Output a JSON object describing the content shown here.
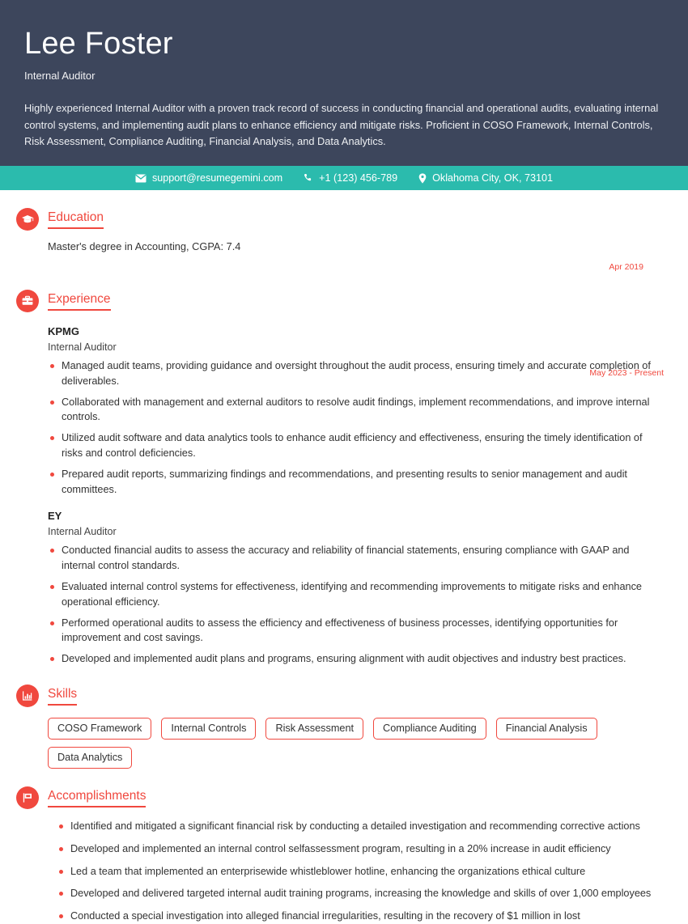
{
  "header": {
    "name": "Lee Foster",
    "job_title": "Internal Auditor",
    "summary": "Highly experienced Internal Auditor with a proven track record of success in conducting financial and operational audits, evaluating internal control systems, and implementing audit plans to enhance efficiency and mitigate risks. Proficient in COSO Framework, Internal Controls, Risk Assessment, Compliance Auditing, Financial Analysis, and Data Analytics."
  },
  "contact": {
    "email": "support@resumegemini.com",
    "phone": "+1 (123) 456-789",
    "location": "Oklahoma City, OK, 73101",
    "email_icon": "envelope-icon",
    "phone_icon": "phone-icon",
    "location_icon": "map-pin-icon"
  },
  "sections": {
    "education": {
      "title": "Education",
      "icon": "graduation-cap-icon",
      "degree": "Master's degree in Accounting, CGPA: 7.4",
      "date": "Apr 2019"
    },
    "experience": {
      "title": "Experience",
      "icon": "briefcase-icon",
      "entries": [
        {
          "company": "KPMG",
          "role": "Internal Auditor",
          "date": "May 2023 - Present",
          "bullets": [
            "Managed audit teams, providing guidance and oversight throughout the audit process, ensuring timely and accurate completion of deliverables.",
            "Collaborated with management and external auditors to resolve audit findings, implement recommendations, and improve internal controls.",
            "Utilized audit software and data analytics tools to enhance audit efficiency and effectiveness, ensuring the timely identification of risks and control deficiencies.",
            "Prepared audit reports, summarizing findings and recommendations, and presenting results to senior management and audit committees."
          ]
        },
        {
          "company": "EY",
          "role": "Internal Auditor",
          "date": "",
          "bullets": [
            "Conducted financial audits to assess the accuracy and reliability of financial statements, ensuring compliance with GAAP and internal control standards.",
            "Evaluated internal control systems for effectiveness, identifying and recommending improvements to mitigate risks and enhance operational efficiency.",
            "Performed operational audits to assess the efficiency and effectiveness of business processes, identifying opportunities for improvement and cost savings.",
            "Developed and implemented audit plans and programs, ensuring alignment with audit objectives and industry best practices."
          ]
        }
      ]
    },
    "skills": {
      "title": "Skills",
      "icon": "bar-chart-icon",
      "items": [
        "COSO Framework",
        "Internal Controls",
        "Risk Assessment",
        "Compliance Auditing",
        "Financial Analysis",
        "Data Analytics"
      ]
    },
    "accomplishments": {
      "title": "Accomplishments",
      "icon": "flag-icon",
      "items": [
        "Identified and mitigated a significant financial risk by conducting a detailed investigation and recommending corrective actions",
        "Developed and implemented an internal control selfassessment program, resulting in a 20% increase in audit efficiency",
        "Led a team that implemented an enterprisewide whistleblower hotline, enhancing the organizations ethical culture",
        "Developed and delivered targeted internal audit training programs, increasing the knowledge and skills of over 1,000 employees",
        "Conducted a special investigation into alleged financial irregularities, resulting in the recovery of $1 million in lost"
      ]
    }
  },
  "colors": {
    "header_bg": "#3d465c",
    "contact_bar": "#2bbbad",
    "accent": "#f0483e",
    "body_text": "#333333"
  }
}
